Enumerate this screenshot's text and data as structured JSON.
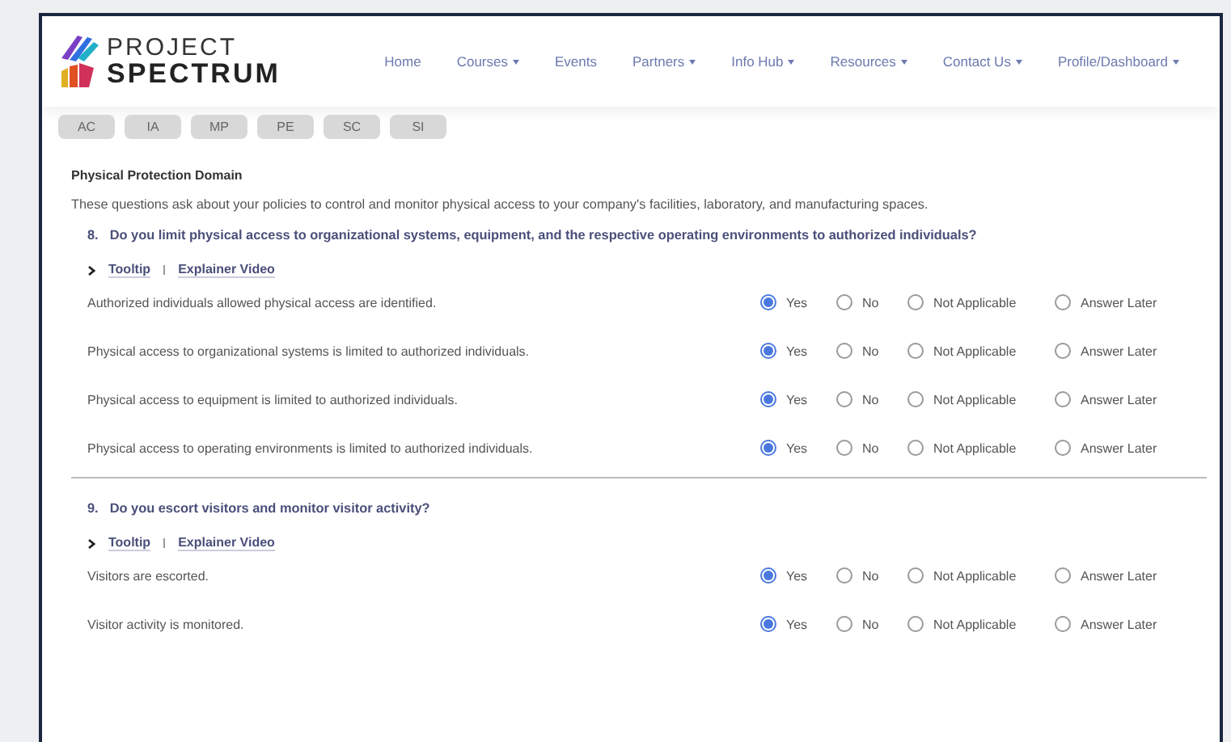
{
  "logo": {
    "line_1": "PROJECT",
    "line_2": "SPECTRUM"
  },
  "nav": [
    {
      "label": "Home",
      "dropdown": false
    },
    {
      "label": "Courses",
      "dropdown": true
    },
    {
      "label": "Events",
      "dropdown": false
    },
    {
      "label": "Partners",
      "dropdown": true
    },
    {
      "label": "Info Hub",
      "dropdown": true
    },
    {
      "label": "Resources",
      "dropdown": true
    },
    {
      "label": "Contact Us",
      "dropdown": true
    },
    {
      "label": "Profile/Dashboard",
      "dropdown": true
    }
  ],
  "domain_tabs": [
    "AC",
    "IA",
    "MP",
    "PE",
    "SC",
    "SI"
  ],
  "section": {
    "title": "Physical Protection Domain",
    "description": "These questions ask about your policies to control and monitor physical access to your company's facilities, laboratory, and manufacturing spaces."
  },
  "questions": [
    {
      "number": "8.",
      "text": "Do you limit physical access to organizational systems, equipment, and the respective operating environments to authorized individuals?",
      "links": [
        "Tooltip",
        "Explainer Video"
      ],
      "items": [
        {
          "text": "Authorized individuals allowed physical access are identified.",
          "options": [
            {
              "label": "Yes",
              "selected": true
            },
            {
              "label": "No",
              "selected": false
            },
            {
              "label": "Not Applicable",
              "selected": false
            },
            {
              "label": "Answer Later",
              "selected": false
            }
          ]
        },
        {
          "text": "Physical access to organizational systems is limited to authorized individuals.",
          "options": [
            {
              "label": "Yes",
              "selected": true
            },
            {
              "label": "No",
              "selected": false
            },
            {
              "label": "Not Applicable",
              "selected": false
            },
            {
              "label": "Answer Later",
              "selected": false
            }
          ]
        },
        {
          "text": "Physical access to equipment is limited to authorized individuals.",
          "options": [
            {
              "label": "Yes",
              "selected": true
            },
            {
              "label": "No",
              "selected": false
            },
            {
              "label": "Not Applicable",
              "selected": false
            },
            {
              "label": "Answer Later",
              "selected": false
            }
          ]
        },
        {
          "text": "Physical access to operating environments is limited to authorized individuals.",
          "options": [
            {
              "label": "Yes",
              "selected": true
            },
            {
              "label": "No",
              "selected": false
            },
            {
              "label": "Not Applicable",
              "selected": false
            },
            {
              "label": "Answer Later",
              "selected": false
            }
          ]
        }
      ]
    },
    {
      "number": "9.",
      "text": "Do you escort visitors and monitor visitor activity?",
      "links": [
        "Tooltip",
        "Explainer Video"
      ],
      "items": [
        {
          "text": "Visitors are escorted.",
          "options": [
            {
              "label": "Yes",
              "selected": true
            },
            {
              "label": "No",
              "selected": false
            },
            {
              "label": "Not Applicable",
              "selected": false
            },
            {
              "label": "Answer Later",
              "selected": false
            }
          ]
        },
        {
          "text": "Visitor activity is monitored.",
          "options": [
            {
              "label": "Yes",
              "selected": true
            },
            {
              "label": "No",
              "selected": false
            },
            {
              "label": "Not Applicable",
              "selected": false
            },
            {
              "label": "Answer Later",
              "selected": false
            }
          ]
        }
      ]
    }
  ]
}
